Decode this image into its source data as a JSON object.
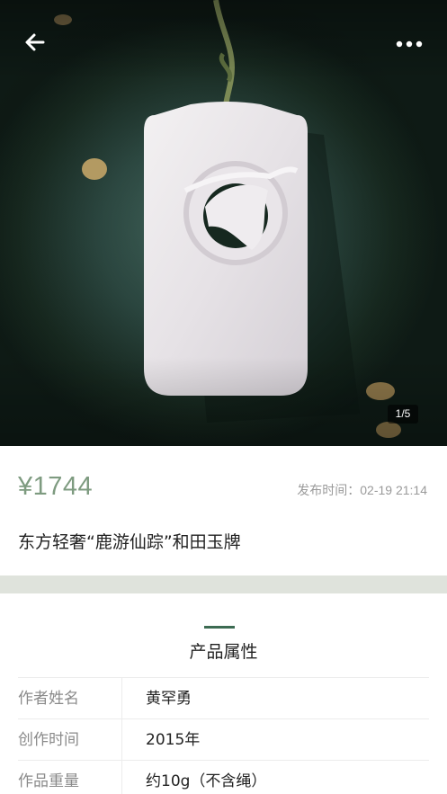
{
  "hero": {
    "image_counter": "1/5",
    "back_icon": "arrow-left-icon",
    "more_icon": "more-dots-icon"
  },
  "product": {
    "price": "¥1744",
    "publish_time": "发布时间：02-19 21:14",
    "title": "东方轻奢“鹿游仙踪”和田玉牌"
  },
  "attributes": {
    "section_title": "产品属性",
    "rows": [
      {
        "key": "作者姓名",
        "value": "黄罕勇"
      },
      {
        "key": "创作时间",
        "value": "2015年"
      },
      {
        "key": "作品重量",
        "value": "约10g（不含绳）"
      }
    ]
  },
  "colors": {
    "price": "#7e9b80",
    "accent": "#3c6b52",
    "band": "#dfe3dc"
  }
}
